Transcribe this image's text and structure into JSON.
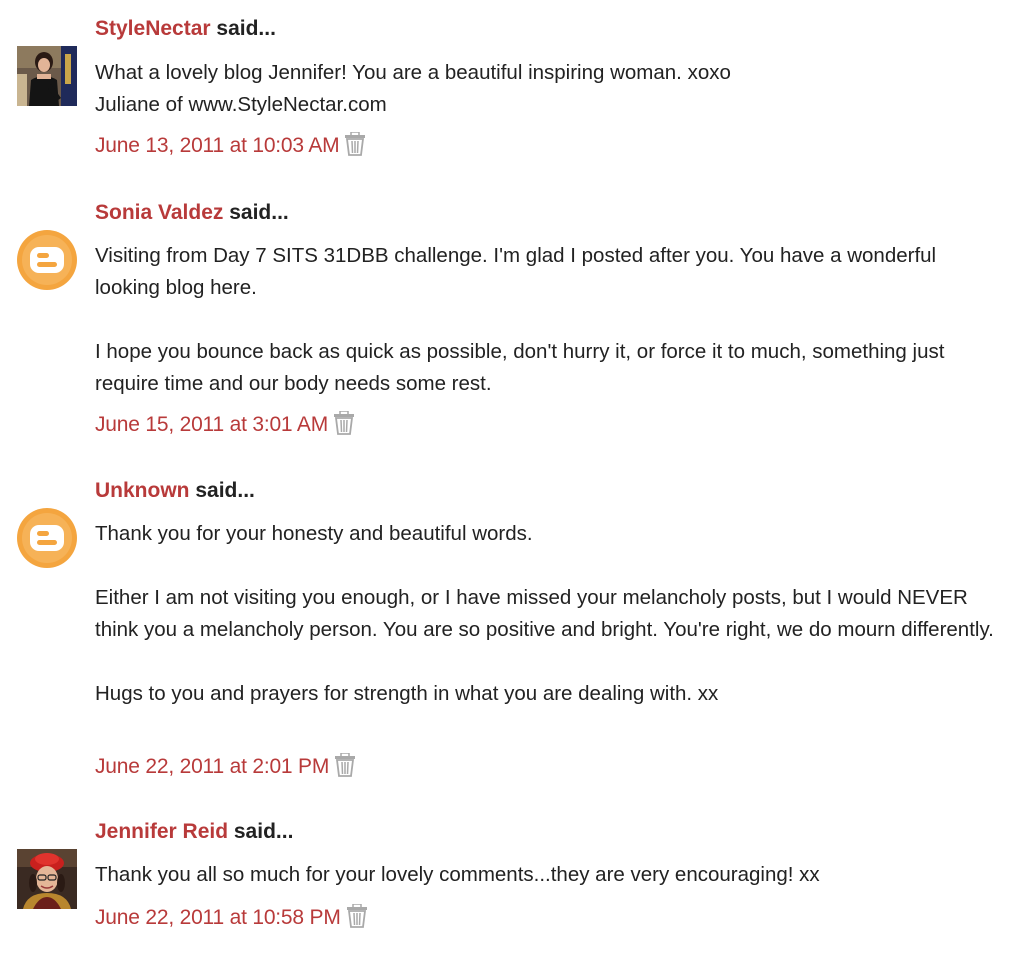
{
  "comments": [
    {
      "author": "StyleNectar",
      "said": " said...",
      "avatar": "photo-avatar",
      "paragraphs": [
        "What a lovely blog Jennifer! You are a beautiful inspiring woman. xoxo",
        "Juliane of www.StyleNectar.com"
      ],
      "timestamp": "June 13, 2011 at 10:03 AM",
      "delete_icon": "trash-icon"
    },
    {
      "author": "Sonia Valdez",
      "said": " said...",
      "avatar": "blogger-icon",
      "paragraphs": [
        "Visiting from Day 7 SITS 31DBB challenge. I'm glad I posted after you. You have a wonderful looking blog here.",
        "I hope you bounce back as quick as possible, don't hurry it, or force it to much, something just require time and our body needs some rest."
      ],
      "timestamp": "June 15, 2011 at 3:01 AM",
      "delete_icon": "trash-icon"
    },
    {
      "author": "Unknown",
      "said": " said...",
      "avatar": "blogger-icon",
      "paragraphs": [
        "Thank you for your honesty and beautiful words.",
        "Either I am not visiting you enough, or I have missed your melancholy posts, but I would NEVER think you a melancholy person. You are so positive and bright. You're right, we do mourn differently.",
        "Hugs to you and prayers for strength in what you are dealing with. xx"
      ],
      "timestamp": "June 22, 2011 at 2:01 PM",
      "delete_icon": "trash-icon"
    },
    {
      "author": "Jennifer Reid",
      "said": " said...",
      "avatar": "photo-avatar",
      "paragraphs": [
        "Thank you all so much for your lovely comments...they are very encouraging! xx"
      ],
      "timestamp": "June 22, 2011 at 10:58 PM",
      "delete_icon": "trash-icon"
    }
  ],
  "colors": {
    "link": "#b83a3a",
    "text": "#222222",
    "blogger_orange": "#f4a53f"
  }
}
